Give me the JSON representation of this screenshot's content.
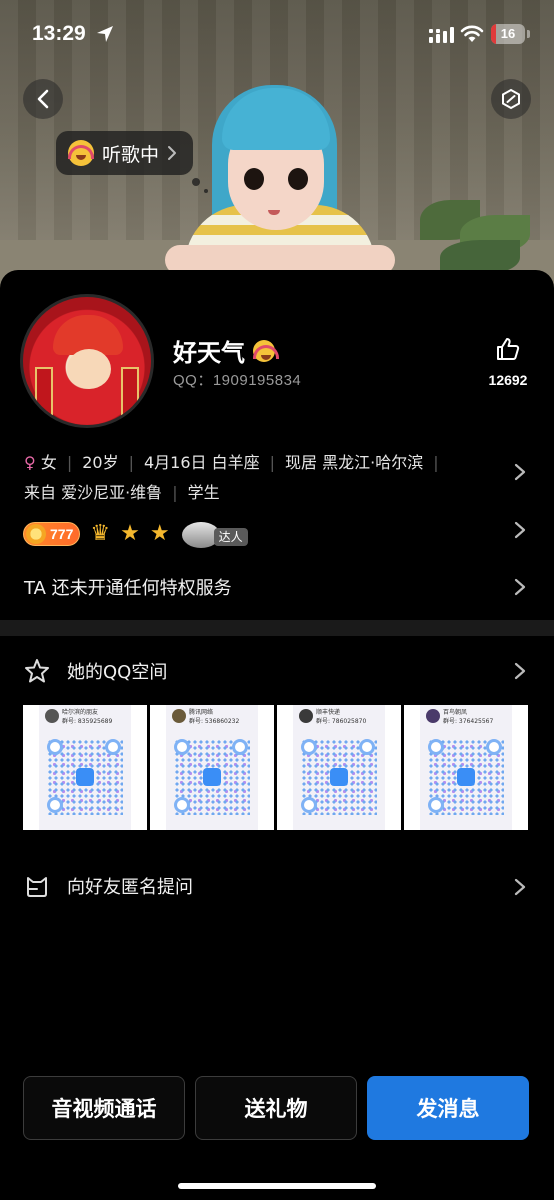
{
  "status_bar": {
    "time": "13:29",
    "battery": "16",
    "battery_level": 0.16,
    "battery_color": "#e03a3a"
  },
  "hero": {
    "status_bubble": "听歌中"
  },
  "profile": {
    "nickname": "好天气",
    "qq_label": "QQ：1909195834",
    "likes": "12692"
  },
  "info": {
    "gender_symbol": "♀",
    "gender": "女",
    "age": "20岁",
    "birthday": "4月16日 白羊座",
    "residence": "现居 黑龙江·哈尔滨",
    "origin": "来自 爱沙尼亚·维鲁",
    "occupation": "学生"
  },
  "badges": {
    "level": "777",
    "daren": "达人"
  },
  "privilege": "TA 还未开通任何特权服务",
  "qzone": {
    "title": "她的QQ空间",
    "thumbs": [
      {
        "name": "哈尔滨的朋友",
        "sub": "群号: 835925689"
      },
      {
        "name": "腾讯网络",
        "sub": "群号: 536860232"
      },
      {
        "name": "顺丰快递",
        "sub": "群号: 786025870"
      },
      {
        "name": "百鸟朝凤",
        "sub": "群号: 376425567"
      }
    ]
  },
  "anon_question": "向好友匿名提问",
  "actions": {
    "call": "音视频通话",
    "gift": "送礼物",
    "message": "发消息"
  },
  "colors": {
    "accent": "#1f79e0",
    "female": "#e86aa8",
    "level_badge": "#ff7a2a"
  }
}
